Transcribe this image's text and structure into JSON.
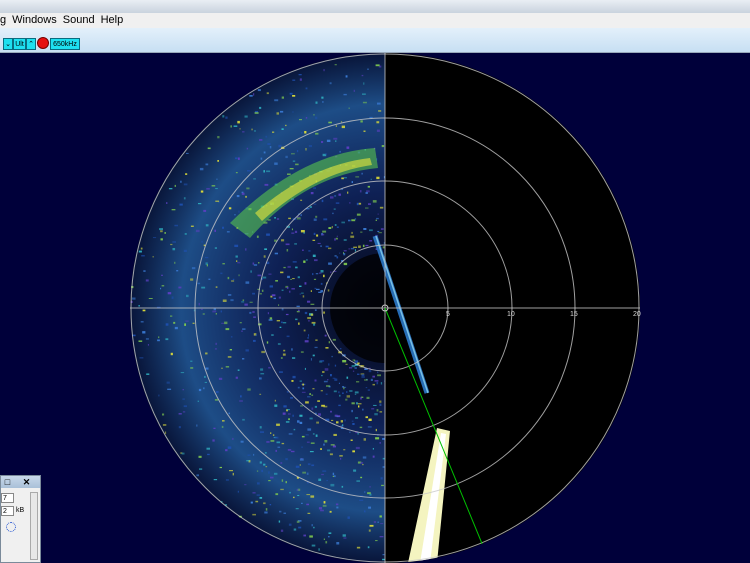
{
  "menu": {
    "items": [
      {
        "label": "g"
      },
      {
        "label": "Windows"
      },
      {
        "label": "Sound"
      },
      {
        "label": "Help"
      }
    ]
  },
  "toolbar": {
    "down_label": "⌄",
    "mode_label": "Ult",
    "up_label": "⌃",
    "frequency_label": "650kHz"
  },
  "sonar": {
    "range_labels": [
      "5",
      "10",
      "15",
      "20"
    ],
    "colors": {
      "background": "#000038",
      "rings": "#c8c8c8",
      "heading": "#00c000"
    }
  },
  "mini_panel": {
    "restore_icon": "□",
    "close_icon": "✕",
    "field1_value": "7",
    "field2_value": "2",
    "field2_unit": "kB"
  }
}
